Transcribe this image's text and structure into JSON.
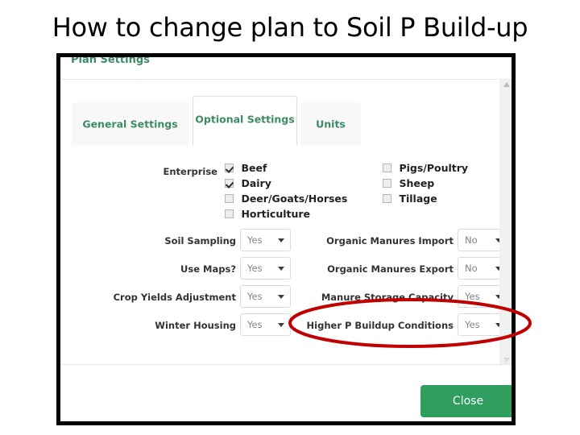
{
  "slide": {
    "title": "How to change plan to Soil P Build-up"
  },
  "dialog": {
    "title": "Plan Settings",
    "tabs": [
      {
        "label": "General Settings",
        "active": false
      },
      {
        "label": "Optional Settings",
        "active": true
      },
      {
        "label": "Units",
        "active": false
      }
    ],
    "enterprise": {
      "label": "Enterprise",
      "left_options": [
        {
          "label": "Beef",
          "checked": true
        },
        {
          "label": "Dairy",
          "checked": true
        },
        {
          "label": "Deer/Goats/Horses",
          "checked": false
        },
        {
          "label": "Horticulture",
          "checked": false
        }
      ],
      "right_options": [
        {
          "label": "Pigs/Poultry",
          "checked": false
        },
        {
          "label": "Sheep",
          "checked": false
        },
        {
          "label": "Tillage",
          "checked": false
        }
      ]
    },
    "fields_left": [
      {
        "label": "Soil Sampling",
        "value": "Yes"
      },
      {
        "label": "Use Maps?",
        "value": "Yes"
      },
      {
        "label": "Crop Yields Adjustment",
        "value": "Yes"
      },
      {
        "label": "Winter Housing",
        "value": "Yes"
      }
    ],
    "fields_right": [
      {
        "label": "Organic Manures Import",
        "value": "No"
      },
      {
        "label": "Organic Manures Export",
        "value": "No"
      },
      {
        "label": "Manure Storage Capacity",
        "value": "Yes"
      },
      {
        "label": "Higher P Buildup Conditions",
        "value": "Yes"
      }
    ],
    "footer": {
      "close_label": "Close"
    },
    "colors": {
      "tab_text_green": "#3d8b66",
      "close_button_green": "#2f9e5f",
      "annotation_red": "#c00000"
    }
  }
}
